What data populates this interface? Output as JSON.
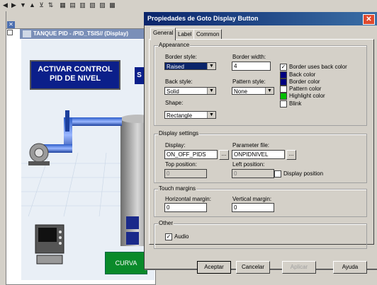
{
  "toolbar": {
    "icons": [
      "first-icon",
      "prev-icon",
      "down-icon",
      "up-icon",
      "filter-icon",
      "sort-icon",
      "grid-icon",
      "window-icon",
      "table-icon",
      "chart-icon",
      "print-icon",
      "image-icon"
    ]
  },
  "background_window": {
    "title": "TANQUE PID - /PID_TSIS// (Display)",
    "button_activate": "ACTIVAR CONTROL\nPID DE NIVEL",
    "button_s": "S",
    "button_curva": "CURVA"
  },
  "dialog": {
    "title": "Propiedades de Goto Display Button",
    "tabs": [
      "General",
      "Label",
      "Common"
    ],
    "appearance": {
      "group_label": "Appearance",
      "border_style_label": "Border style:",
      "border_style_value": "Raised",
      "border_width_label": "Border width:",
      "border_width_value": "4",
      "back_style_label": "Back style:",
      "back_style_value": "Solid",
      "pattern_style_label": "Pattern style:",
      "pattern_style_value": "None",
      "shape_label": "Shape:",
      "shape_value": "Rectangle",
      "border_uses_back_color": "Border uses back color",
      "back_color": "Back color",
      "border_color": "Border color",
      "pattern_color": "Pattern color",
      "highlight_color": "Highlight color",
      "blink": "Blink",
      "colors": {
        "back": "#000080",
        "border": "#000080",
        "pattern": "#ffffff",
        "highlight": "#00c000"
      }
    },
    "display_settings": {
      "group_label": "Display settings",
      "display_label": "Display:",
      "display_value": "ON_OFF_PIDS",
      "parameter_file_label": "Parameter file:",
      "parameter_file_value": "ONPIDNIVEL",
      "top_position_label": "Top position:",
      "top_position_value": "0",
      "left_position_label": "Left position:",
      "left_position_value": "0",
      "display_position": "Display position"
    },
    "touch_margins": {
      "group_label": "Touch margins",
      "horizontal_label": "Horizontal margin:",
      "horizontal_value": "0",
      "vertical_label": "Vertical margin:",
      "vertical_value": "0"
    },
    "other": {
      "group_label": "Other",
      "audio": "Audio"
    },
    "buttons": {
      "ok": "Aceptar",
      "cancel": "Cancelar",
      "apply": "Aplicar",
      "help": "Ayuda"
    },
    "close_glyph": "✕"
  }
}
